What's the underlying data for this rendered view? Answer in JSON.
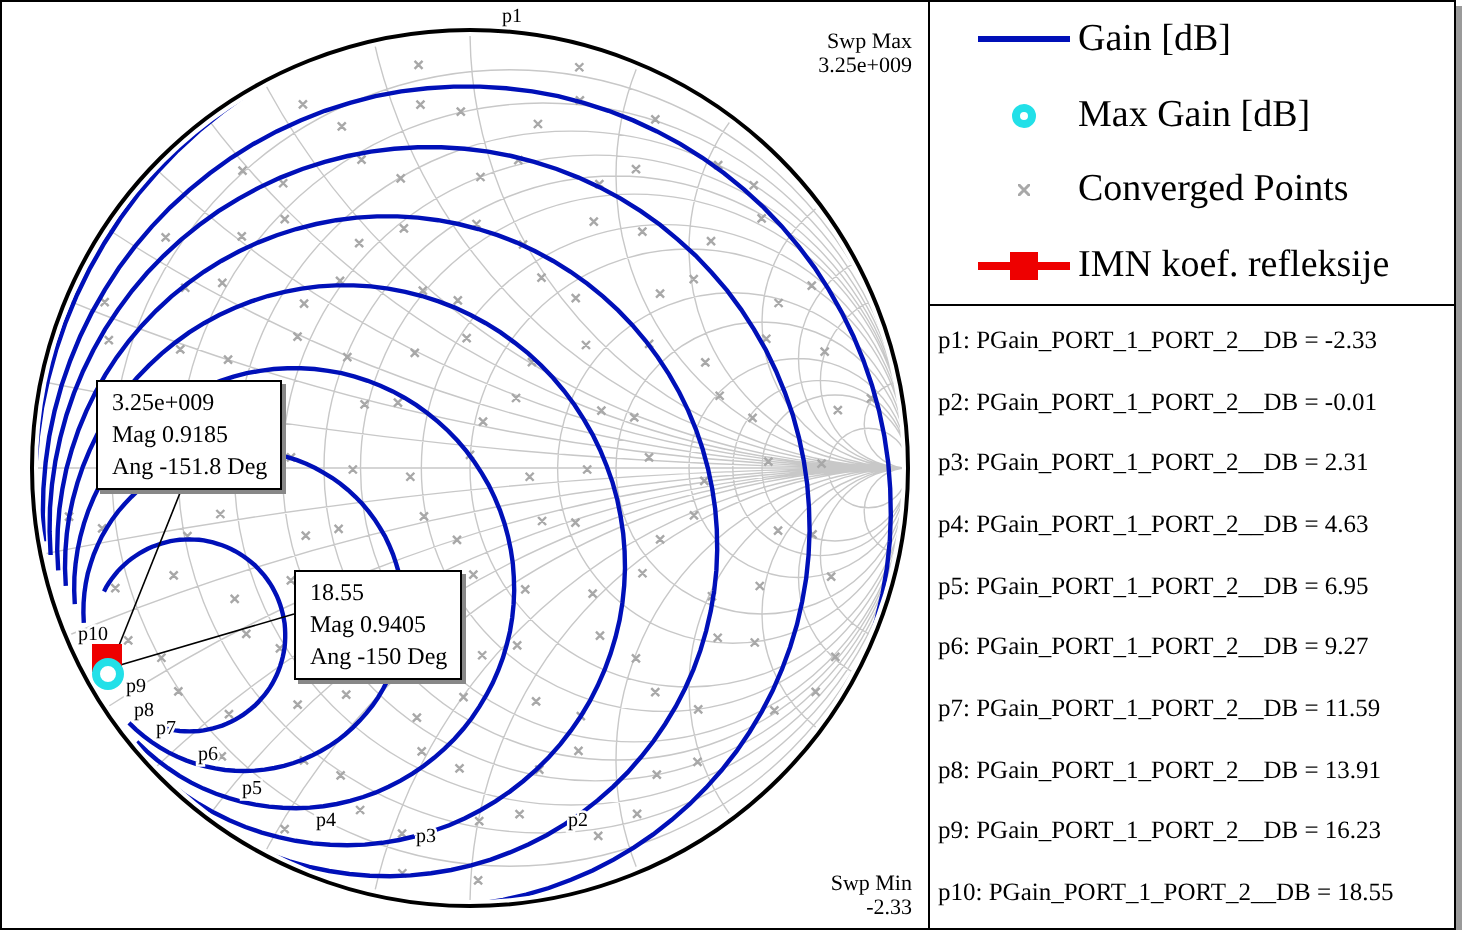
{
  "chart": {
    "sweep_max": {
      "label": "Swp Max",
      "value": "3.25e+009"
    },
    "sweep_min": {
      "label": "Swp Min",
      "value": "-2.33"
    },
    "contour_labels": [
      "p1",
      "p2",
      "p3",
      "p4",
      "p5",
      "p6",
      "p7",
      "p8"
    ],
    "point_labels": [
      "p9",
      "p10"
    ],
    "callouts": [
      {
        "lines": [
          "3.25e+009",
          "Mag 0.9185",
          "Ang -151.8 Deg"
        ]
      },
      {
        "lines": [
          "18.55",
          "Mag 0.9405",
          "Ang -150 Deg"
        ]
      }
    ]
  },
  "legend": [
    {
      "kind": "line",
      "label": "Gain [dB]"
    },
    {
      "kind": "dot",
      "label": "Max Gain [dB]"
    },
    {
      "kind": "cross",
      "label": "Converged Points"
    },
    {
      "kind": "square-line",
      "label": "IMN koef. refleksije"
    }
  ],
  "markers": [
    "p1: PGain_PORT_1_PORT_2__DB = -2.33",
    "p2: PGain_PORT_1_PORT_2__DB = -0.01",
    "p3: PGain_PORT_1_PORT_2__DB = 2.31",
    "p4: PGain_PORT_1_PORT_2__DB = 4.63",
    "p5: PGain_PORT_1_PORT_2__DB = 6.95",
    "p6: PGain_PORT_1_PORT_2__DB = 9.27",
    "p7: PGain_PORT_1_PORT_2__DB = 11.59",
    "p8: PGain_PORT_1_PORT_2__DB = 13.91",
    "p9: PGain_PORT_1_PORT_2__DB = 16.23",
    "p10: PGain_PORT_1_PORT_2__DB = 18.55"
  ]
}
